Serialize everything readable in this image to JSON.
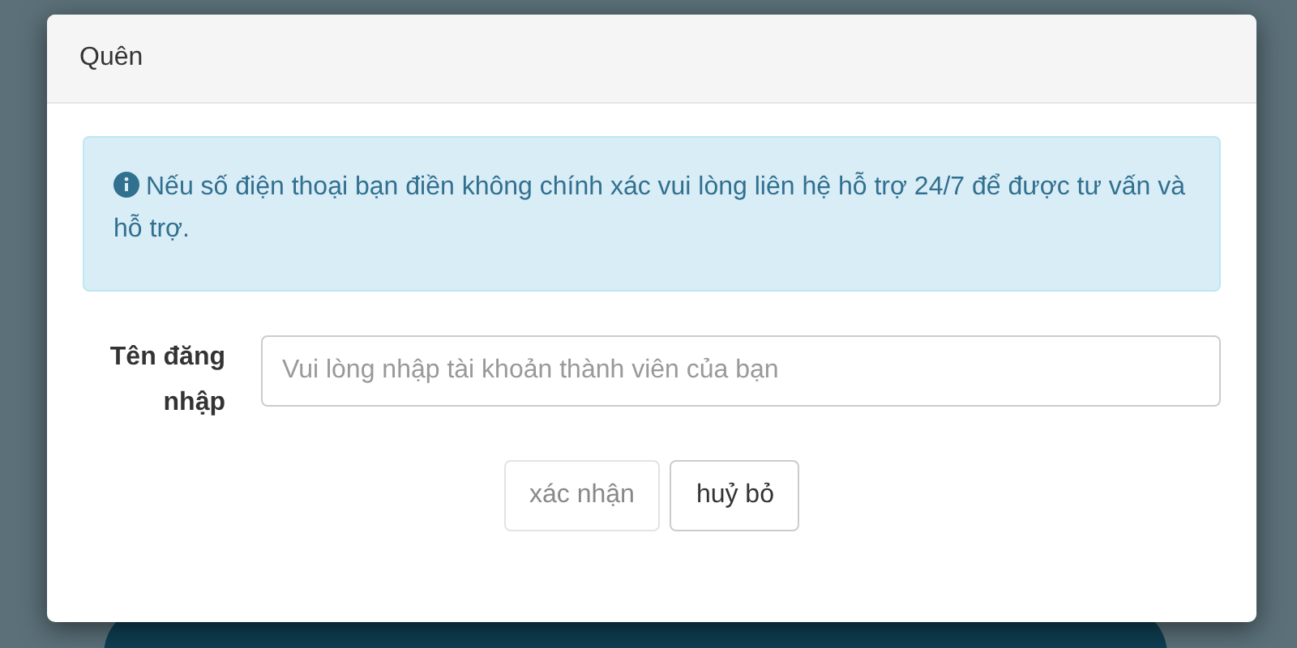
{
  "dialog": {
    "title": "Quên"
  },
  "alert": {
    "text": "Nếu số điện thoại bạn điền không chính xác vui lòng liên hệ hỗ trợ 24/7 để được tư vấn và hỗ trợ."
  },
  "form": {
    "label": "Tên đăng nhập",
    "placeholder": "Vui lòng nhập tài khoản thành viên của bạn"
  },
  "buttons": [
    {
      "label": "xác nhận",
      "disabled": true
    },
    {
      "label": "huỷ bỏ",
      "disabled": false
    }
  ]
}
